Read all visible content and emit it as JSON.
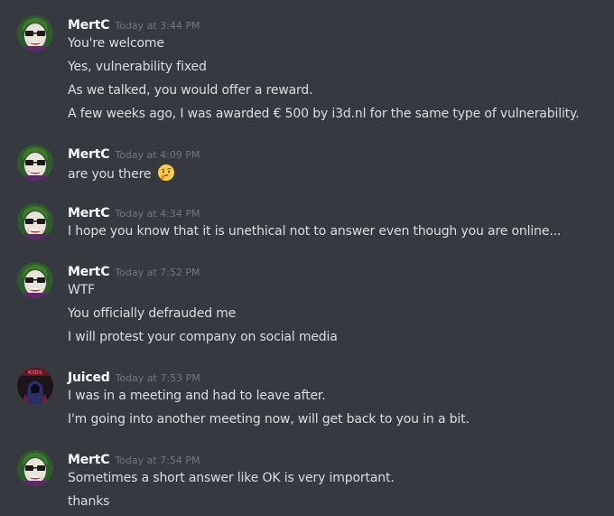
{
  "messages": [
    {
      "author": "MertC",
      "avatar": "joker-avatar-icon",
      "time": "Today at 3:44 PM",
      "lines": [
        "You're welcome",
        "Yes, vulnerability fixed",
        "As we talked, you would offer a reward.",
        "A few weeks ago, I was awarded € 500 by i3d.nl for the same type of vulnerability."
      ]
    },
    {
      "author": "MertC",
      "avatar": "joker-avatar-icon",
      "time": "Today at 4:09 PM",
      "lines": [
        "are you there"
      ],
      "emoji": "thinking-face-emoji"
    },
    {
      "author": "MertC",
      "avatar": "joker-avatar-icon",
      "time": "Today at 4:34 PM",
      "lines": [
        "I hope you know that it is unethical not to answer even though you are online..."
      ]
    },
    {
      "author": "MertC",
      "avatar": "joker-avatar-icon",
      "time": "Today at 7:52 PM",
      "lines": [
        "WTF",
        "You officially defrauded me",
        "I will protest your company on social media"
      ]
    },
    {
      "author": "Juiced",
      "avatar": "hooded-figure-avatar-icon",
      "time": "Today at 7:53 PM",
      "lines": [
        "I was in a meeting and had to leave after.",
        "I'm going into another meeting now, will get back to you in a bit."
      ]
    },
    {
      "author": "MertC",
      "avatar": "joker-avatar-icon",
      "time": "Today at 7:54 PM",
      "lines": [
        "Sometimes a short answer like OK is very important.",
        "thanks"
      ]
    }
  ],
  "colors": {
    "background": "#36393f",
    "username": "#ffffff",
    "timestamp": "#72767d",
    "message_text": "#dcddde"
  }
}
